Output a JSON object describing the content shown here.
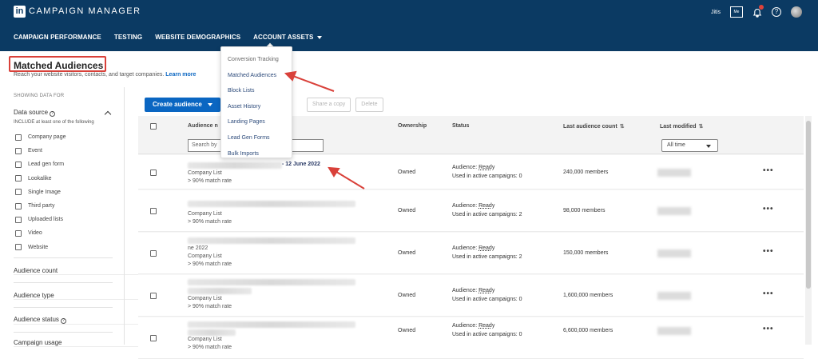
{
  "header": {
    "logo_text": "in",
    "title": "CAMPAIGN MANAGER",
    "account_name": "Jitis",
    "account_badge": "Me",
    "nav": [
      {
        "label": "CAMPAIGN PERFORMANCE"
      },
      {
        "label": "TESTING"
      },
      {
        "label": "WEBSITE DEMOGRAPHICS"
      },
      {
        "label": "ACCOUNT ASSETS"
      }
    ],
    "help_glyph": "?",
    "icons": [
      "bell-icon",
      "help-icon",
      "avatar"
    ]
  },
  "account_assets_menu": [
    "Conversion Tracking",
    "Matched Audiences",
    "Block Lists",
    "Asset History",
    "Landing Pages",
    "Lead Gen Forms",
    "Bulk Imports"
  ],
  "page": {
    "title": "Matched Audiences",
    "subtitle": "Reach your website visitors, contacts, and target companies.",
    "learn_more": "Learn more"
  },
  "sidebar": {
    "showing_label": "SHOWING DATA FOR",
    "data_source_label": "Data source",
    "include_text": "INCLUDE at least one of the following",
    "sources": [
      "Company page",
      "Event",
      "Lead gen form",
      "Lookalike",
      "Single Image",
      "Third party",
      "Uploaded lists",
      "Video",
      "Website"
    ],
    "filters": [
      "Audience count",
      "Audience type",
      "Audience status",
      "Campaign usage"
    ]
  },
  "toolbar": {
    "create_label": "Create audience",
    "share_label": "Share a copy",
    "delete_label": "Delete"
  },
  "table": {
    "columns": {
      "name": "Audience n",
      "ownership": "Ownership",
      "status": "Status",
      "count": "Last audience count",
      "modified": "Last modified"
    },
    "search_placeholder": "Search by",
    "date_filter": "All time",
    "rows": [
      {
        "date_suffix": "- 12 June 2022",
        "extra": "",
        "type": "Company List",
        "match": "> 90% match rate",
        "ownership": "Owned",
        "status_prefix": "Audience:",
        "status_value": "Ready",
        "campaigns": "Used in active campaigns: 0",
        "count": "240,000 members"
      },
      {
        "date_suffix": "",
        "extra": "",
        "type": "Company List",
        "match": "> 90% match rate",
        "ownership": "Owned",
        "status_prefix": "Audience:",
        "status_value": "Ready",
        "campaigns": "Used in active campaigns: 2",
        "count": "98,000 members"
      },
      {
        "date_suffix": "",
        "extra": "ne 2022",
        "type": "Company List",
        "match": "> 90% match rate",
        "ownership": "Owned",
        "status_prefix": "Audience:",
        "status_value": "Ready",
        "campaigns": "Used in active campaigns: 2",
        "count": "150,000 members"
      },
      {
        "date_suffix": "",
        "extra": "",
        "type": "Company List",
        "match": "> 90% match rate",
        "ownership": "Owned",
        "status_prefix": "Audience:",
        "status_value": "Ready",
        "campaigns": "Used in active campaigns: 0",
        "count": "1,600,000 members"
      },
      {
        "date_suffix": "",
        "extra": "",
        "type": "Company List",
        "match": "> 90% match rate",
        "ownership": "Owned",
        "status_prefix": "Audience:",
        "status_value": "Ready",
        "campaigns": "Used in active campaigns: 0",
        "count": "6,600,000 members"
      }
    ],
    "more_glyph": "•••",
    "sort_glyph": "⇅"
  },
  "colors": {
    "header_bg": "#0b3a63",
    "accent": "#0a66c2",
    "annotation": "#d9413a"
  }
}
